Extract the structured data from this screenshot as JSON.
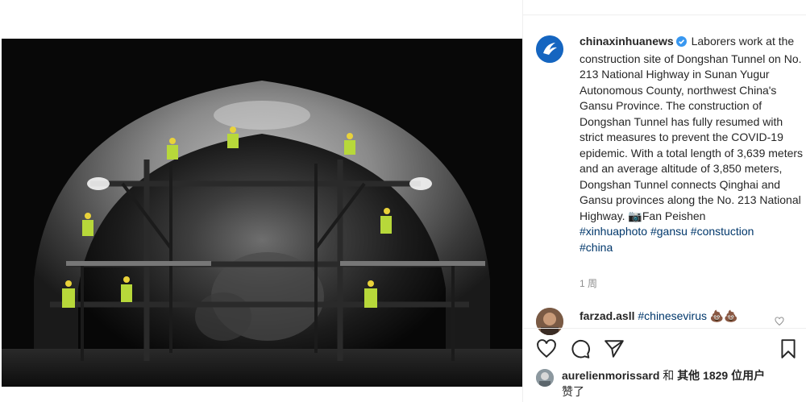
{
  "post": {
    "image_alt": "Laborers on scaffolding inside a lit tunnel construction site",
    "author": "chinaxinhuanews",
    "caption": "Laborers work at the construction site of Dongshan Tunnel on No. 213 National Highway in Sunan Yugur Autonomous County, northwest China's Gansu Province. The construction of Dongshan Tunnel has fully resumed with strict measures to prevent the COVID-19 epidemic. With a total length of 3,639 meters and an average altitude of 3,850 meters, Dongshan Tunnel connects Qinghai and Gansu provinces along the No. 213 National Highway. 📷Fan Peishen",
    "hashtags": [
      "#xinhuaphoto",
      "#gansu",
      "#constuction",
      "#china"
    ],
    "time_ago": "1 周"
  },
  "comment": {
    "author": "farzad.asll",
    "text": "#chinesevirus",
    "emoji": "💩💩"
  },
  "likes": {
    "user": "aurelienmorissard",
    "joiner": "和",
    "others": "其他 1829 位用户",
    "suffix": "赞了"
  },
  "icons": {
    "like": "heart-icon",
    "comment": "comment-icon",
    "share": "share-icon",
    "save": "bookmark-icon",
    "verified": "verified-badge-icon"
  },
  "colors": {
    "link": "#00376b",
    "verified": "#3897f0",
    "muted": "#8e8e8e"
  }
}
